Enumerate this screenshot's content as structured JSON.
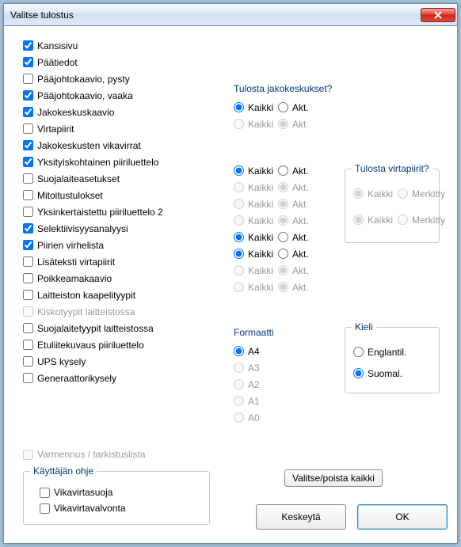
{
  "window": {
    "title": "Valitse tulostus"
  },
  "checkboxes": [
    {
      "label": "Kansisivu",
      "checked": true,
      "disabled": false
    },
    {
      "label": "Päätiedot",
      "checked": true,
      "disabled": false
    },
    {
      "label": "Pääjohtokaavio, pysty",
      "checked": false,
      "disabled": false
    },
    {
      "label": "Pääjohtokaavio, vaaka",
      "checked": true,
      "disabled": false
    },
    {
      "label": "Jakokeskuskaavio",
      "checked": true,
      "disabled": false
    },
    {
      "label": "Virtapiirit",
      "checked": false,
      "disabled": false
    },
    {
      "label": "Jakokeskusten vikavirrat",
      "checked": true,
      "disabled": false
    },
    {
      "label": "Yksityiskohtainen piiriluettelo",
      "checked": true,
      "disabled": false
    },
    {
      "label": "Suojalaiteasetukset",
      "checked": false,
      "disabled": false
    },
    {
      "label": "Mitoitustulokset",
      "checked": false,
      "disabled": false
    },
    {
      "label": "Yksinkertaistettu piiriluettelo 2",
      "checked": false,
      "disabled": false
    },
    {
      "label": "Selektiivisyysanalyysi",
      "checked": true,
      "disabled": false
    },
    {
      "label": "Piirien virhelista",
      "checked": true,
      "disabled": false
    },
    {
      "label": "Lisäteksti virtapiirit",
      "checked": false,
      "disabled": false
    },
    {
      "label": "Poikkeamakaavio",
      "checked": false,
      "disabled": false
    },
    {
      "label": "Laitteiston kaapelityypit",
      "checked": false,
      "disabled": false
    },
    {
      "label": "Kiskotyypit laitteistossa",
      "checked": false,
      "disabled": true
    },
    {
      "label": "Suojalaitetyypit laitteistossa",
      "checked": false,
      "disabled": false
    },
    {
      "label": "Etuliitekuvaus piiriluettelo",
      "checked": false,
      "disabled": false
    },
    {
      "label": "UPS kysely",
      "checked": false,
      "disabled": false
    },
    {
      "label": "Generaattorikysely",
      "checked": false,
      "disabled": false
    }
  ],
  "jako": {
    "title": "Tulosta jakokeskukset?",
    "opt1": "Kaikki",
    "opt2": "Akt.",
    "rows": [
      {
        "enabled": true,
        "sel": 0
      },
      {
        "enabled": false,
        "sel": 1
      }
    ]
  },
  "piir": {
    "opt1": "Kaikki",
    "opt2": "Akt.",
    "rows": [
      {
        "enabled": true,
        "sel": 0
      },
      {
        "enabled": false,
        "sel": 1
      },
      {
        "enabled": false,
        "sel": 1
      },
      {
        "enabled": false,
        "sel": 1
      },
      {
        "enabled": true,
        "sel": 0
      },
      {
        "enabled": true,
        "sel": 0
      },
      {
        "enabled": false,
        "sel": 1
      },
      {
        "enabled": false,
        "sel": 1
      }
    ]
  },
  "virtap": {
    "title": "Tulosta virtapiirit?",
    "opt1": "Kaikki",
    "opt2": "Merkitty",
    "rows": [
      {
        "sel": 0
      },
      {
        "sel": 0
      }
    ]
  },
  "formaatti": {
    "title": "Formaatti",
    "options": [
      "A4",
      "A3",
      "A2",
      "A1",
      "A0"
    ],
    "selected": 0
  },
  "kieli": {
    "title": "Kieli",
    "options": [
      "Englantil.",
      "Suomal."
    ],
    "selected": 1
  },
  "varmennus": {
    "label": "Varmennus / tarkistuslista",
    "checked": false
  },
  "ohje": {
    "title": "Käyttäjän ohje",
    "items": [
      {
        "label": "Vikavirtasuoja",
        "checked": false
      },
      {
        "label": "Vikavirtavalvonta",
        "checked": false
      }
    ]
  },
  "buttons": {
    "selectAll": "Valitse/poista kaikki",
    "cancel": "Keskeytä",
    "ok": "OK"
  }
}
